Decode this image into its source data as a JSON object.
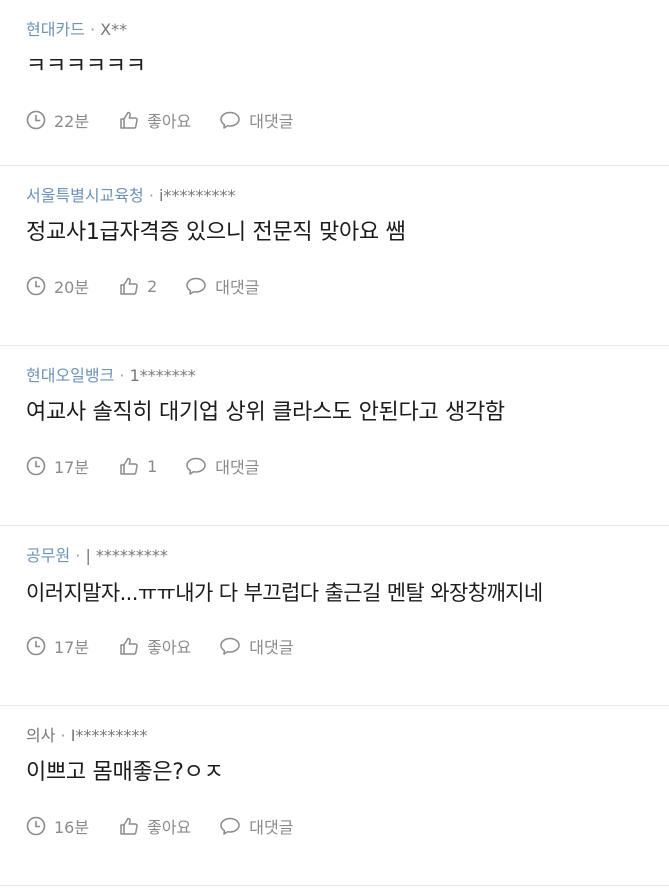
{
  "comments": [
    {
      "company": "현대카드",
      "separator": "·",
      "user": "X**",
      "text": "ㅋㅋㅋㅋㅋㅋ",
      "time": "22분",
      "like": "좋아요",
      "reply": "대댓글"
    },
    {
      "company": "서울특별시교육청",
      "separator": "·",
      "user": "i*********",
      "text": "정교사1급자격증 있으니 전문직 맞아요 쌤",
      "time": "20분",
      "like": "2",
      "reply": "대댓글"
    },
    {
      "company": "현대오일뱅크",
      "separator": "·",
      "user": "1*******",
      "text": "여교사 솔직히 대기업 상위 클라스도 안된다고 생각함",
      "time": "17분",
      "like": "1",
      "reply": "대댓글"
    },
    {
      "company": "공무원",
      "separator": "·",
      "user": "| *********",
      "text": "이러지말자...ㅠㅠ내가 다 부끄럽다 출근길 멘탈 와장창깨지네",
      "time": "17분",
      "like": "좋아요",
      "reply": "대댓글"
    },
    {
      "company": "의사",
      "separator": "·",
      "user": "I*********",
      "text": "이쁘고 몸매좋은?ㅇㅈ",
      "time": "16분",
      "like": "좋아요",
      "reply": "대댓글"
    }
  ],
  "colors": {
    "company": "#6c93b8",
    "icon": "#8a8a8a",
    "divider": "#e9e9e9"
  }
}
